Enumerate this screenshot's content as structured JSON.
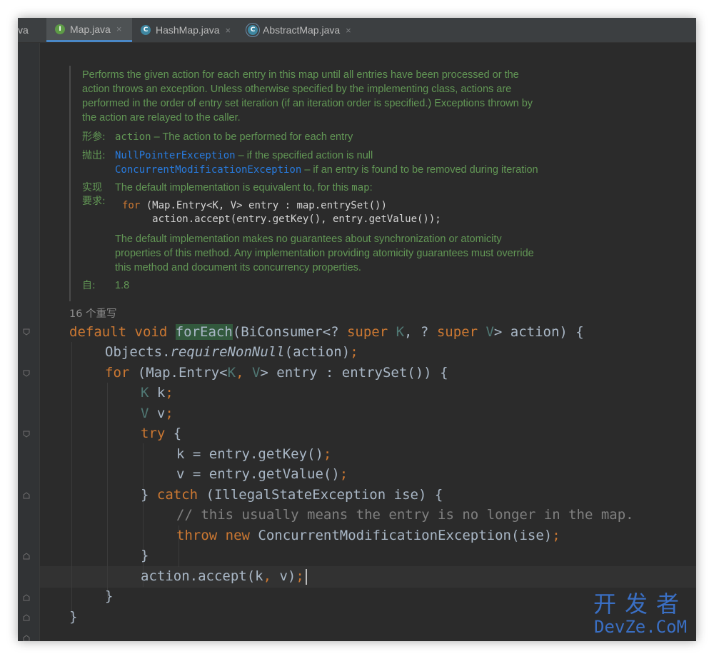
{
  "tabs": [
    {
      "label": "va",
      "icon": "none",
      "active": false
    },
    {
      "label": "Map.java",
      "icon": "interface-icon",
      "active": true
    },
    {
      "label": "HashMap.java",
      "icon": "class-icon",
      "active": false
    },
    {
      "label": "AbstractMap.java",
      "icon": "abstract-class-icon",
      "active": false
    }
  ],
  "tab_icon_letters": {
    "interface": "I",
    "class": "C"
  },
  "close_glyph": "×",
  "doc": {
    "description": [
      "Performs the given action for each entry in this map until all entries have been processed or the",
      "action throws an exception. Unless otherwise specified by the implementing class, actions are",
      "performed in the order of entry set iteration (if an iteration order is specified.) Exceptions thrown by",
      "the action are relayed to the caller."
    ],
    "param_label": "形参:",
    "param_name": "action",
    "param_desc": " – The action to be performed for each entry",
    "throws_label": "抛出:",
    "throws": [
      {
        "name": "NullPointerException",
        "desc": " – if the specified action is null"
      },
      {
        "name": "ConcurrentModificationException",
        "desc": " – if an entry is found to be removed during iteration"
      }
    ],
    "impl_label_1": "实现",
    "impl_label_2": "要求:",
    "impl_intro_a": "The default implementation is equivalent to, for this ",
    "impl_intro_code": "map",
    "impl_intro_b": ":",
    "impl_code_kw": "for",
    "impl_code_1": " (Map.Entry<K, V> entry : map.entrySet())",
    "impl_code_2": "     action.accept(entry.getKey(), entry.getValue());",
    "impl_note": [
      "The default implementation makes no guarantees about synchronization or atomicity",
      "properties of this method. Any implementation providing atomicity guarantees must override",
      "this method and document its concurrency properties."
    ],
    "since_label": "自:",
    "since_value": "1.8"
  },
  "overrides_hint": "16 个重写",
  "code": {
    "l1": {
      "kw": "default void ",
      "method": "forEach",
      "a": "(BiConsumer<? ",
      "kw2": "super ",
      "t1": "K",
      "b": ", ? ",
      "kw3": "super ",
      "t2": "V",
      "c": "> action) {"
    },
    "l2": {
      "a": "Objects.",
      "method": "requireNonNull",
      "b": "(action)",
      "semi": ";"
    },
    "l3": {
      "kw": "for ",
      "a": "(Map.Entry<",
      "t1": "K",
      "b": ", ",
      "t2": "V",
      "c": "> entry : entrySet()) {"
    },
    "l4": {
      "t": "K",
      "a": " k",
      "semi": ";"
    },
    "l5": {
      "t": "V",
      "a": " v",
      "semi": ";"
    },
    "l6": {
      "kw": "try ",
      "a": "{"
    },
    "l7": {
      "a": "k = entry.getKey()",
      "semi": ";"
    },
    "l8": {
      "a": "v = entry.getValue()",
      "semi": ";"
    },
    "l9": {
      "a": "} ",
      "kw": "catch ",
      "b": "(IllegalStateException ise) {"
    },
    "l10": {
      "comment": "// this usually means the entry is no longer in the map."
    },
    "l11": {
      "kw": "throw new ",
      "a": "ConcurrentModificationException(ise)",
      "semi": ";"
    },
    "l12": {
      "a": "}"
    },
    "l13": {
      "a": "action.accept(k",
      "comma": ", ",
      "b": "v)",
      "semi": ";"
    },
    "l14": {
      "a": "}"
    },
    "l15": {
      "a": "}"
    }
  },
  "watermark": {
    "line1": "开发者",
    "line2": "DevZe.CoM"
  },
  "colors": {
    "background": "#2b2b2b",
    "keyword": "#cc7832",
    "doc_text": "#629755",
    "doc_link": "#287bde",
    "type_param": "#507874",
    "method_highlight": "#32593d",
    "comment": "#808080"
  }
}
